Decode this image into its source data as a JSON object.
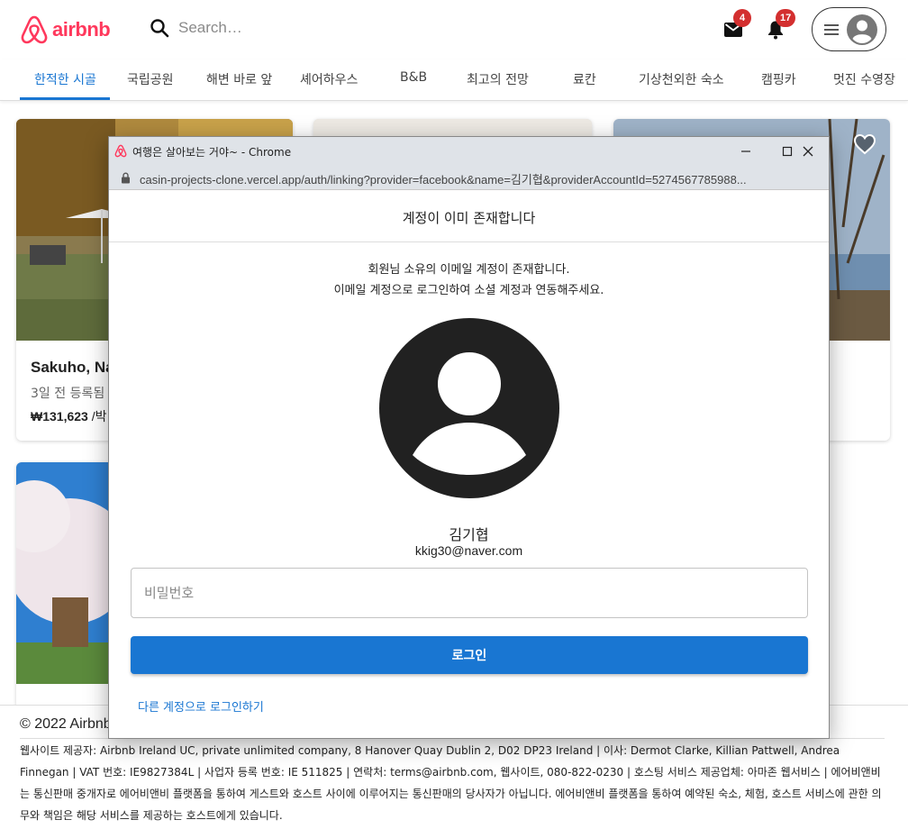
{
  "header": {
    "logo_text": "airbnb",
    "search_placeholder": "Search…",
    "mail_badge": "4",
    "notification_badge": "17"
  },
  "tabs": [
    {
      "label": "한적한 시골"
    },
    {
      "label": "국립공원"
    },
    {
      "label": "해변 바로 앞"
    },
    {
      "label": "셰어하우스"
    },
    {
      "label": "B&B"
    },
    {
      "label": "최고의 전망"
    },
    {
      "label": "료칸"
    },
    {
      "label": "기상천외한 숙소"
    },
    {
      "label": "캠핑카"
    },
    {
      "label": "멋진 수영장"
    }
  ],
  "cards": [
    {
      "title": "Sakuho, Na",
      "subtitle": "3일 전 등록됨",
      "price": "₩131,623",
      "price_unit": " /박"
    }
  ],
  "footer": {
    "copyright": "© 2022 Airbnb",
    "legal": "웹사이트 제공자: Airbnb Ireland UC, private unlimited company, 8 Hanover Quay Dublin 2, D02 DP23 Ireland | 이사: Dermot Clarke, Killian Pattwell, Andrea Finnegan | VAT 번호: IE9827384L | 사업자 등록 번호: IE 511825 | 연락처: terms@airbnb.com, 웹사이트, 080-822-0230 | 호스팅 서비스 제공업체: 아마존 웹서비스 | 에어비앤비는 통신판매 중개자로 에어비앤비 플랫폼을 통하여 게스트와 호스트 사이에 이루어지는 통신판매의 당사자가 아닙니다. 에어비앤비 플랫폼을 통하여 예약된 숙소, 체험, 호스트 서비스에 관한 의무와 책임은 해당 서비스를 제공하는 호스트에게 있습니다."
  },
  "popup": {
    "window_title": "여행은 살아보는 거야~ - Chrome",
    "url": "casin-projects-clone.vercel.app/auth/linking?provider=facebook&name=김기협&providerAccountId=5274567785988...",
    "dialog_title": "계정이 이미 존재합니다",
    "message_line1": "회원님 소유의 이메일 계정이 존재합니다.",
    "message_line2": "이메일 계정으로 로그인하여 소셜 계정과 연동해주세요.",
    "user_name": "김기협",
    "user_email": "kkig30@naver.com",
    "password_placeholder": "비밀번호",
    "login_button": "로그인",
    "other_account_link": "다른 계정으로 로그인하기"
  },
  "colors": {
    "brand": "#ff385c",
    "accent": "#1976d2",
    "badge": "#d32f2f"
  }
}
